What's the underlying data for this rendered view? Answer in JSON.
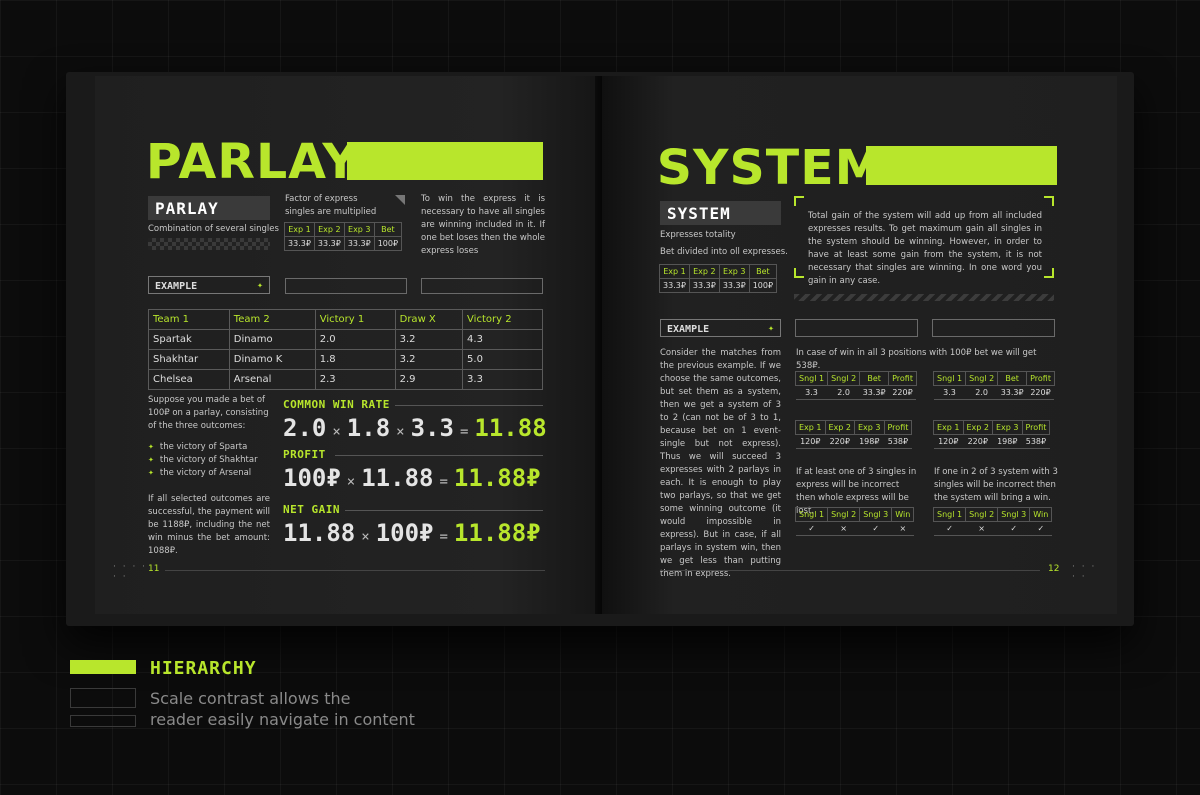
{
  "left": {
    "title": "PARLAY",
    "tag": "PARLAY",
    "tag_caption": "Combination of several singles",
    "factor_text": "Factor of express singles are multiplied",
    "mini_table": {
      "headers": [
        "Exp 1",
        "Exp 2",
        "Exp 3",
        "Bet"
      ],
      "values": [
        "33.3₽",
        "33.3₽",
        "33.3₽",
        "100₽"
      ]
    },
    "win_text": "To win the express it is necessary to have all singles are winning included in it. If one bet loses then the whole express loses",
    "example_label": "EXAMPLE",
    "teams_table": {
      "headers": [
        "Team 1",
        "Team 2",
        "Victory 1",
        "Draw X",
        "Victory 2"
      ],
      "rows": [
        [
          "Spartak",
          "Dinamo",
          "2.0",
          "3.2",
          "4.3"
        ],
        [
          "Shakhtar",
          "Dinamo K",
          "1.8",
          "3.2",
          "5.0"
        ],
        [
          "Chelsea",
          "Arsenal",
          "2.3",
          "2.9",
          "3.3"
        ]
      ]
    },
    "suppose_text": "Suppose you made a bet of 100₽ on a parlay, consisting of the three outcomes:",
    "bullets": [
      "the victory of Sparta",
      "the victory of Shakhtar",
      "the victory of Arsenal"
    ],
    "if_text": "If all selected outcomes are successful, the payment will be 1188₽, including the net win minus the bet amount: 1088₽.",
    "formulas": [
      {
        "label": "COMMON WIN RATE",
        "parts": [
          "2.0",
          "×",
          "1.8",
          "×",
          "3.3",
          "="
        ],
        "result": "11.88"
      },
      {
        "label": "PROFIT",
        "parts": [
          "100₽",
          "×",
          "11.88",
          "="
        ],
        "result": "11.88₽"
      },
      {
        "label": "NET GAIN",
        "parts": [
          "11.88",
          "×",
          "100₽",
          "="
        ],
        "result": "11.88₽"
      }
    ],
    "page_number": "11"
  },
  "right": {
    "title": "SYSTEM",
    "tag": "SYSTEM",
    "tag_caption": "Expresses totality",
    "divided_text": "Bet divided into oll expresses.",
    "mini_table": {
      "headers": [
        "Exp 1",
        "Exp 2",
        "Exp 3",
        "Bet"
      ],
      "values": [
        "33.3₽",
        "33.3₽",
        "33.3₽",
        "100₽"
      ]
    },
    "total_text": "Total gain of the system will add up from all included expresses results. To get maximum gain all singles in the system should be winning. However, in order to have at least some gain from the system, it is not necessary that singles are winning. In one word you gain in any case.",
    "example_label": "EXAMPLE",
    "consider_text": "Consider the matches from the previous example. If we choose the same outcomes, but set them as a system, then we get a system of 3 to 2 (can not be of 3 to 1, because bet on 1 event-single but not express). Thus we will succeed 3 expresses with 2 parlays in each. It is enough to play two parlays, so that we get some winning outcome (it would impossible in express). But in case, if all parlays in system win, then we get less than putting them in express.",
    "case_text": "In case of win in all 3 positions with 100₽ bet we will get 538₽.",
    "singles_table": {
      "headers": [
        "Sngl 1",
        "Sngl 2",
        "Bet",
        "Profit"
      ],
      "values": [
        "3.3",
        "2.0",
        "33.3₽",
        "220₽"
      ]
    },
    "exp_table": {
      "headers": [
        "Exp 1",
        "Exp 2",
        "Exp 3",
        "Profit"
      ],
      "values": [
        "120₽",
        "220₽",
        "198₽",
        "538₽"
      ]
    },
    "atleast_text": "If at least one of 3 singles in express will be incorrect then whole express will be lost.",
    "oneof_text": "If one in 2 of 3 system with 3 singles will be incorrect then the system will bring a win.",
    "outcome_headers": [
      "Sngl 1",
      "Sngl 2",
      "Sngl 3",
      "Win"
    ],
    "outcome_left": [
      "✓",
      "×",
      "✓",
      "×"
    ],
    "outcome_right": [
      "✓",
      "×",
      "✓",
      "✓"
    ],
    "page_number": "12"
  },
  "legend": {
    "title": "HIERARCHY",
    "line1": "Scale contrast allows the",
    "line2": "reader easily navigate in content"
  }
}
